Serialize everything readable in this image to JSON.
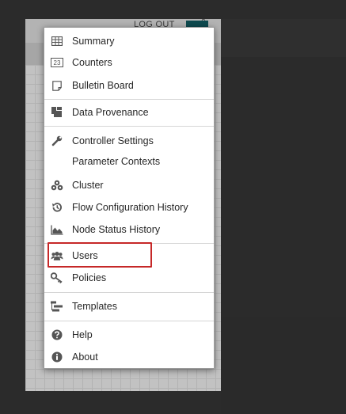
{
  "header": {
    "logout_label": "LOG OUT",
    "close_glyph": "×"
  },
  "colors": {
    "highlight": "#c62828",
    "icon": "#555555",
    "menu_toggle": "#0e4a4f"
  },
  "menu": {
    "items": [
      {
        "label": "Summary",
        "icon": "table-icon"
      },
      {
        "label": "Counters",
        "icon": "counters-icon"
      },
      {
        "label": "Bulletin Board",
        "icon": "bulletin-board-icon"
      },
      {
        "label": "Data Provenance",
        "icon": "provenance-icon"
      },
      {
        "label": "Controller Settings",
        "icon": "wrench-icon"
      },
      {
        "label": "Parameter Contexts",
        "icon": ""
      },
      {
        "label": "Cluster",
        "icon": "cluster-icon"
      },
      {
        "label": "Flow Configuration History",
        "icon": "history-icon"
      },
      {
        "label": "Node Status History",
        "icon": "area-chart-icon"
      },
      {
        "label": "Users",
        "icon": "users-icon",
        "highlighted": true
      },
      {
        "label": "Policies",
        "icon": "key-icon"
      },
      {
        "label": "Templates",
        "icon": "templates-icon"
      },
      {
        "label": "Help",
        "icon": "question-circle-icon"
      },
      {
        "label": "About",
        "icon": "info-circle-icon"
      }
    ],
    "counters_glyph": "23"
  }
}
